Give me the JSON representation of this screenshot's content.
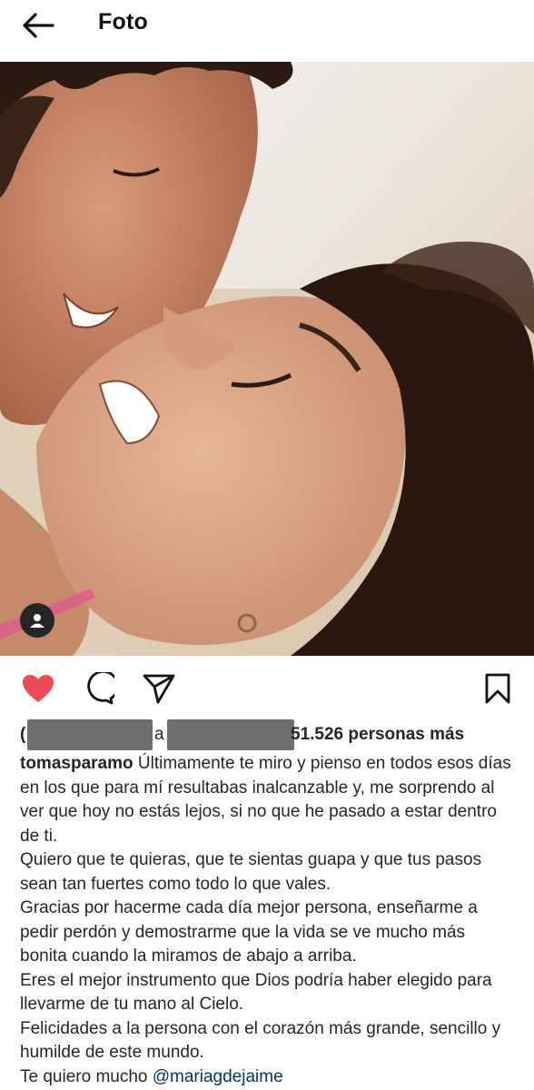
{
  "header": {
    "title": "Foto",
    "back_icon": "arrow-left-icon"
  },
  "post": {
    "photo_alt": "",
    "tag_icon": "user-tag-icon",
    "actions": {
      "like_icon": "heart-filled-icon",
      "comment_icon": "comment-icon",
      "share_icon": "send-icon",
      "save_icon": "bookmark-icon",
      "like_color": "#ed4956"
    },
    "likes": {
      "prefix_char": "(",
      "middle_char": "a",
      "suffix_text": "51.526 personas más"
    },
    "caption": {
      "username": "tomasparamo",
      "line1": " Últimamente te miro y pienso en todos esos días en los que para mí resultabas inalcanzable y, me sorprendo al ver que hoy no estás lejos, si no que he pasado a estar dentro de ti.",
      "line2": "Quiero que te quieras, que te sientas guapa y que tus pasos sean tan fuertes como todo lo que vales.",
      "line3": "Gracias por hacerme cada día mejor persona, enseñarme a pedir perdón y demostrarme que la vida se ve mucho más bonita cuando la miramos de abajo a arriba.",
      "line4": "Eres el mejor instrumento que Dios podría haber elegido para llevarme de tu mano al Cielo.",
      "line5": "Felicidades a la persona con el corazón más grande, sencillo y humilde de este mundo.",
      "line6_text": "Te quiero mucho ",
      "mention": "@mariagdejaime"
    }
  }
}
